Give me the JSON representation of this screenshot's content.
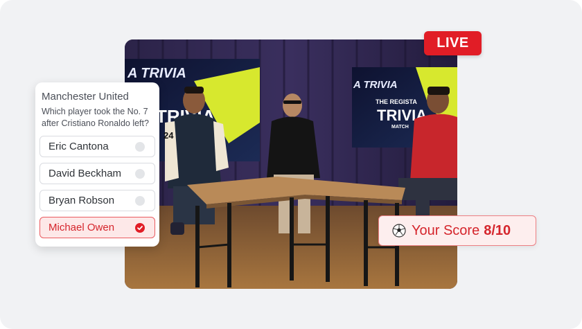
{
  "live_badge": {
    "label": "LIVE"
  },
  "quiz": {
    "team": "Manchester United",
    "question": "Which player took the No. 7 after Cristiano Ronaldo left?",
    "answers": [
      {
        "label": "Eric Cantona",
        "selected": false
      },
      {
        "label": "David Beckham",
        "selected": false
      },
      {
        "label": "Bryan Robson",
        "selected": false
      },
      {
        "label": "Michael Owen",
        "selected": true
      }
    ]
  },
  "video": {
    "screen_left_text": "A TRIVIA",
    "screen_right_text": "A TRIVIA",
    "logo_line1": "THE REGISTA",
    "logo_line2": "TRIVIA",
    "logo_line3": "MATCH",
    "jersey_number": "24"
  },
  "score": {
    "icon": "soccer-ball-icon",
    "label": "Your Score",
    "value": "8/10"
  },
  "colors": {
    "accent_red": "#e11d26",
    "selected_bg": "#fde8e8",
    "background": "#f1f2f4"
  }
}
